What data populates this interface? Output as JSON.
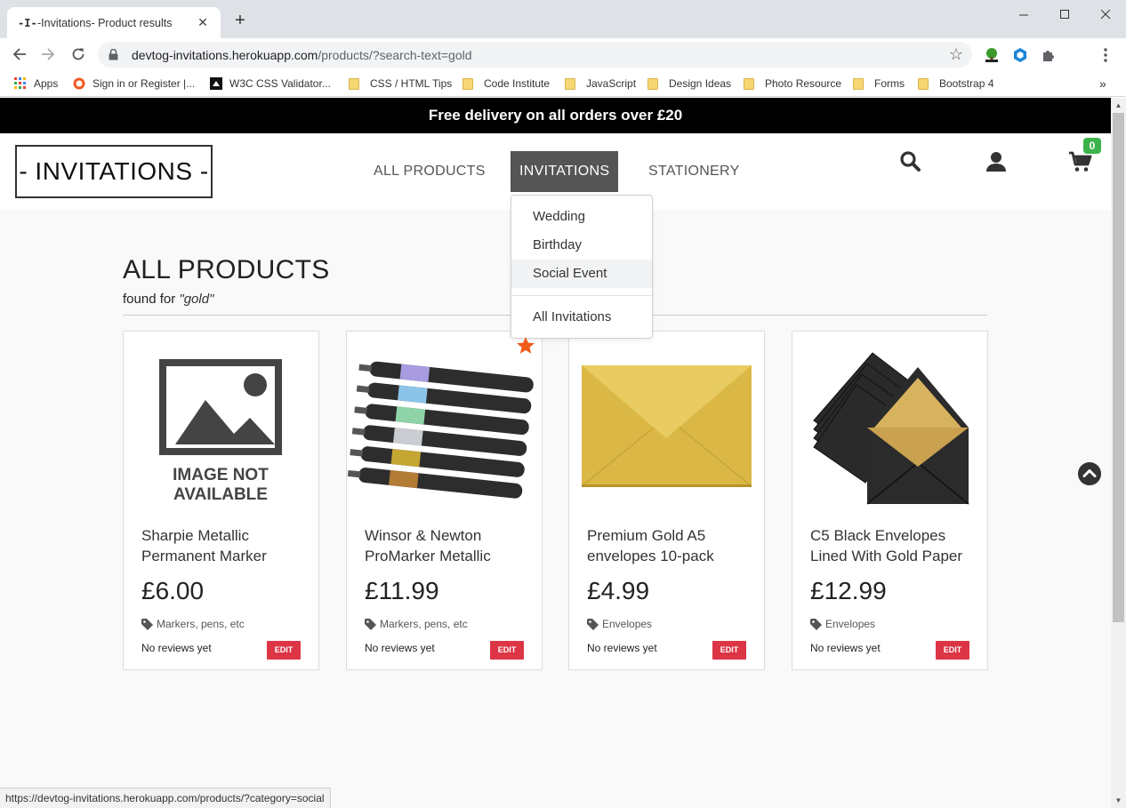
{
  "browser": {
    "tab_favicon": "-I-",
    "tab_title": "-Invitations- Product results",
    "new_tab": "+",
    "url_host": "devtog-invitations.herokuapp.com",
    "url_path": "/products/?search-text=gold",
    "bookmarks": [
      {
        "label": "Apps"
      },
      {
        "label": "Sign in or Register |..."
      },
      {
        "label": "W3C CSS Validator..."
      },
      {
        "label": "CSS / HTML Tips"
      },
      {
        "label": "Code Institute"
      },
      {
        "label": "JavaScript"
      },
      {
        "label": "Design Ideas"
      },
      {
        "label": "Photo Resource"
      },
      {
        "label": "Forms"
      },
      {
        "label": "Bootstrap 4"
      }
    ],
    "bookmarks_more": "»",
    "status_url": "https://devtog-invitations.herokuapp.com/products/?category=social"
  },
  "site": {
    "banner": "Free delivery on all orders over £20",
    "logo": "- INVITATIONS -",
    "nav": [
      {
        "label": "ALL PRODUCTS"
      },
      {
        "label": "INVITATIONS"
      },
      {
        "label": "STATIONERY"
      }
    ],
    "cart_count": "0",
    "dropdown": [
      {
        "label": "Wedding"
      },
      {
        "label": "Birthday"
      },
      {
        "label": "Social Event"
      },
      {
        "label": "All Invitations"
      }
    ]
  },
  "results": {
    "title": "ALL PRODUCTS",
    "found_prefix": "found for ",
    "found_term": "\"gold\""
  },
  "products": [
    {
      "name": "Sharpie Metallic Permanent Marker",
      "price": "£6.00",
      "category": "Markers, pens, etc",
      "reviews": "No reviews yet",
      "edit": "EDIT",
      "image_text_1": "IMAGE NOT",
      "image_text_2": "AVAILABLE"
    },
    {
      "name": "Winsor & Newton ProMarker Metallic",
      "price": "£11.99",
      "category": "Markers, pens, etc",
      "reviews": "No reviews yet",
      "edit": "EDIT"
    },
    {
      "name": "Premium Gold A5 envelopes 10-pack",
      "price": "£4.99",
      "category": "Envelopes",
      "reviews": "No reviews yet",
      "edit": "EDIT"
    },
    {
      "name": "C5 Black Envelopes Lined With Gold Paper",
      "price": "£12.99",
      "category": "Envelopes",
      "reviews": "No reviews yet",
      "edit": "EDIT"
    }
  ],
  "colors": {
    "banner_bg": "#000000",
    "nav_active_bg": "#555555",
    "cart_badge": "#3cb34a",
    "edit_button": "#dc3545",
    "favorite_star": "#f05a1a"
  }
}
